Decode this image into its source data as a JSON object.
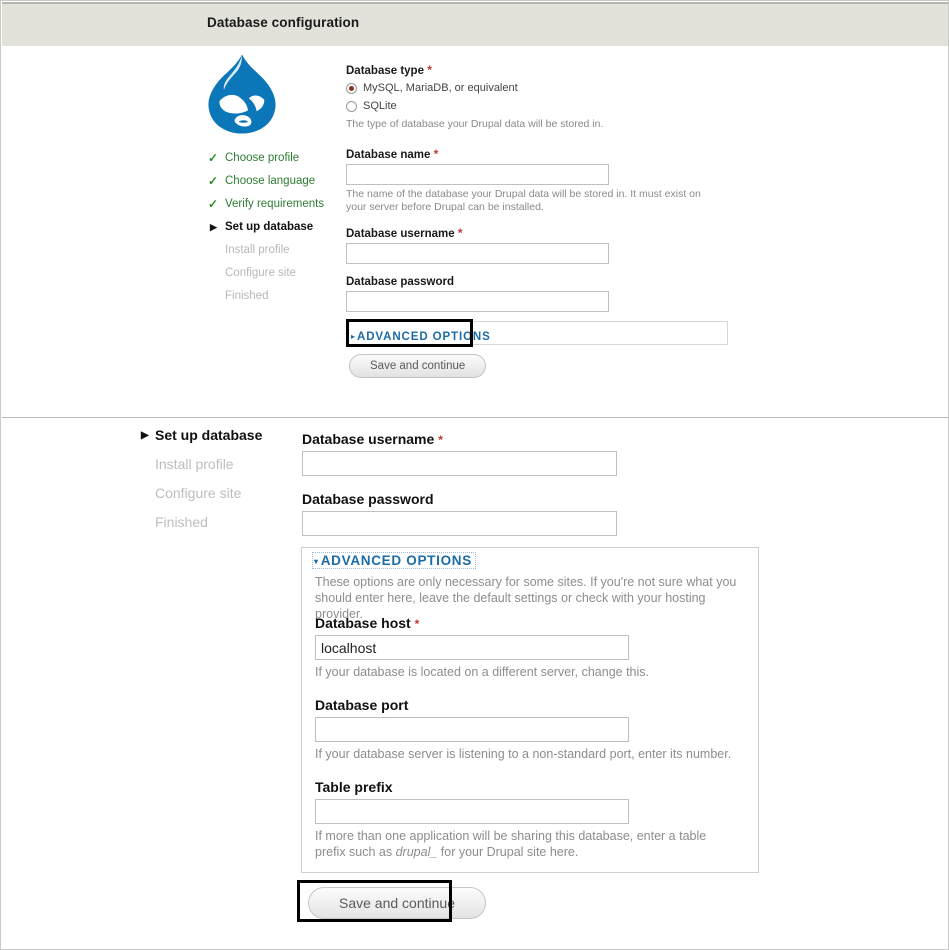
{
  "header": {
    "title": "Database configuration"
  },
  "logo": {
    "name": "drupal-droplet-logo",
    "colors": {
      "primary": "#0678be",
      "dark": "#0d6ba5",
      "light": "#ffffff"
    }
  },
  "top_panel": {
    "steps": [
      {
        "label": "Choose profile",
        "state": "done",
        "marker": "✓"
      },
      {
        "label": "Choose language",
        "state": "done",
        "marker": "✓"
      },
      {
        "label": "Verify requirements",
        "state": "done",
        "marker": "✓"
      },
      {
        "label": "Set up database",
        "state": "active",
        "marker": "▶"
      },
      {
        "label": "Install profile",
        "state": "todo",
        "marker": ""
      },
      {
        "label": "Configure site",
        "state": "todo",
        "marker": ""
      },
      {
        "label": "Finished",
        "state": "todo",
        "marker": ""
      }
    ],
    "database_type": {
      "label": "Database type",
      "required_marker": "*",
      "options": [
        {
          "label": "MySQL, MariaDB, or equivalent",
          "selected": true
        },
        {
          "label": "SQLite",
          "selected": false
        }
      ],
      "help": "The type of database your Drupal data will be stored in."
    },
    "database_name": {
      "label": "Database name",
      "required_marker": "*",
      "value": "",
      "help": "The name of the database your Drupal data will be stored in. It must exist on your server before Drupal can be installed."
    },
    "database_username": {
      "label": "Database username",
      "required_marker": "*",
      "value": ""
    },
    "database_password": {
      "label": "Database password",
      "value": ""
    },
    "advanced_options": {
      "legend": "ADVANCED OPTIONS",
      "triangle": "▸",
      "expanded": false
    },
    "submit": {
      "label": "Save and continue"
    }
  },
  "bottom_panel": {
    "steps": [
      {
        "label": "Set up database",
        "state": "active",
        "marker": "▶"
      },
      {
        "label": "Install profile",
        "state": "todo",
        "marker": ""
      },
      {
        "label": "Configure site",
        "state": "todo",
        "marker": ""
      },
      {
        "label": "Finished",
        "state": "todo",
        "marker": ""
      }
    ],
    "database_username": {
      "label": "Database username",
      "required_marker": "*",
      "value": ""
    },
    "database_password": {
      "label": "Database password",
      "value": ""
    },
    "advanced_options": {
      "legend": "ADVANCED OPTIONS",
      "triangle": "▾",
      "expanded": true,
      "intro": "These options are only necessary for some sites. If you're not sure what you should enter here, leave the default settings or check with your hosting provider.",
      "fields": [
        {
          "label": "Database host",
          "required_marker": "*",
          "value": "localhost",
          "help": "If your database is located on a different server, change this."
        },
        {
          "label": "Database port",
          "required_marker": "",
          "value": "",
          "help": "If your database server is listening to a non-standard port, enter its number."
        },
        {
          "label": "Table prefix",
          "required_marker": "",
          "value": "",
          "help_before": "If more than one application will be sharing this database, enter a table prefix such as ",
          "help_italic": "drupal_",
          "help_after": " for your Drupal site here."
        }
      ]
    },
    "submit": {
      "label": "Save and continue"
    }
  }
}
